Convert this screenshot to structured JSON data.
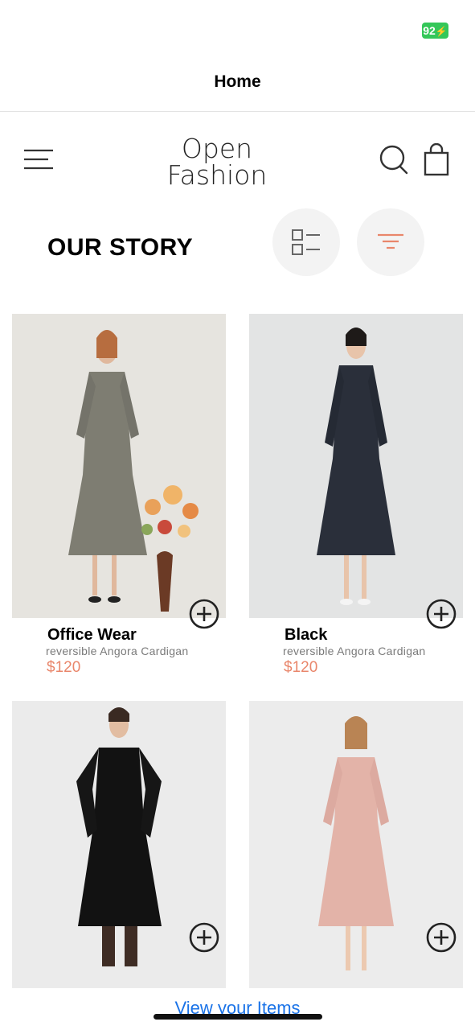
{
  "status_bar": {
    "battery": "92"
  },
  "nav": {
    "title": "Home"
  },
  "header": {
    "logo_line1": "Open",
    "logo_line2": "Fashion",
    "menu_icon": "hamburger-menu-icon",
    "search_icon": "search-icon",
    "bag_icon": "shopping-bag-icon"
  },
  "section": {
    "title": "OUR STORY",
    "view_icon": "list-view-icon",
    "filter_icon": "filter-icon"
  },
  "colors": {
    "price": "#e9866b",
    "link": "#1a73e8",
    "battery": "#34c759"
  },
  "products": [
    {
      "name": "Office Wear",
      "description": "reversible Angora Cardigan",
      "price": "$120"
    },
    {
      "name": "Black",
      "description": "reversible Angora Cardigan",
      "price": "$120"
    },
    {
      "name": "",
      "description": "",
      "price": ""
    },
    {
      "name": "",
      "description": "",
      "price": ""
    }
  ],
  "footer": {
    "view_items": "View your Items"
  }
}
